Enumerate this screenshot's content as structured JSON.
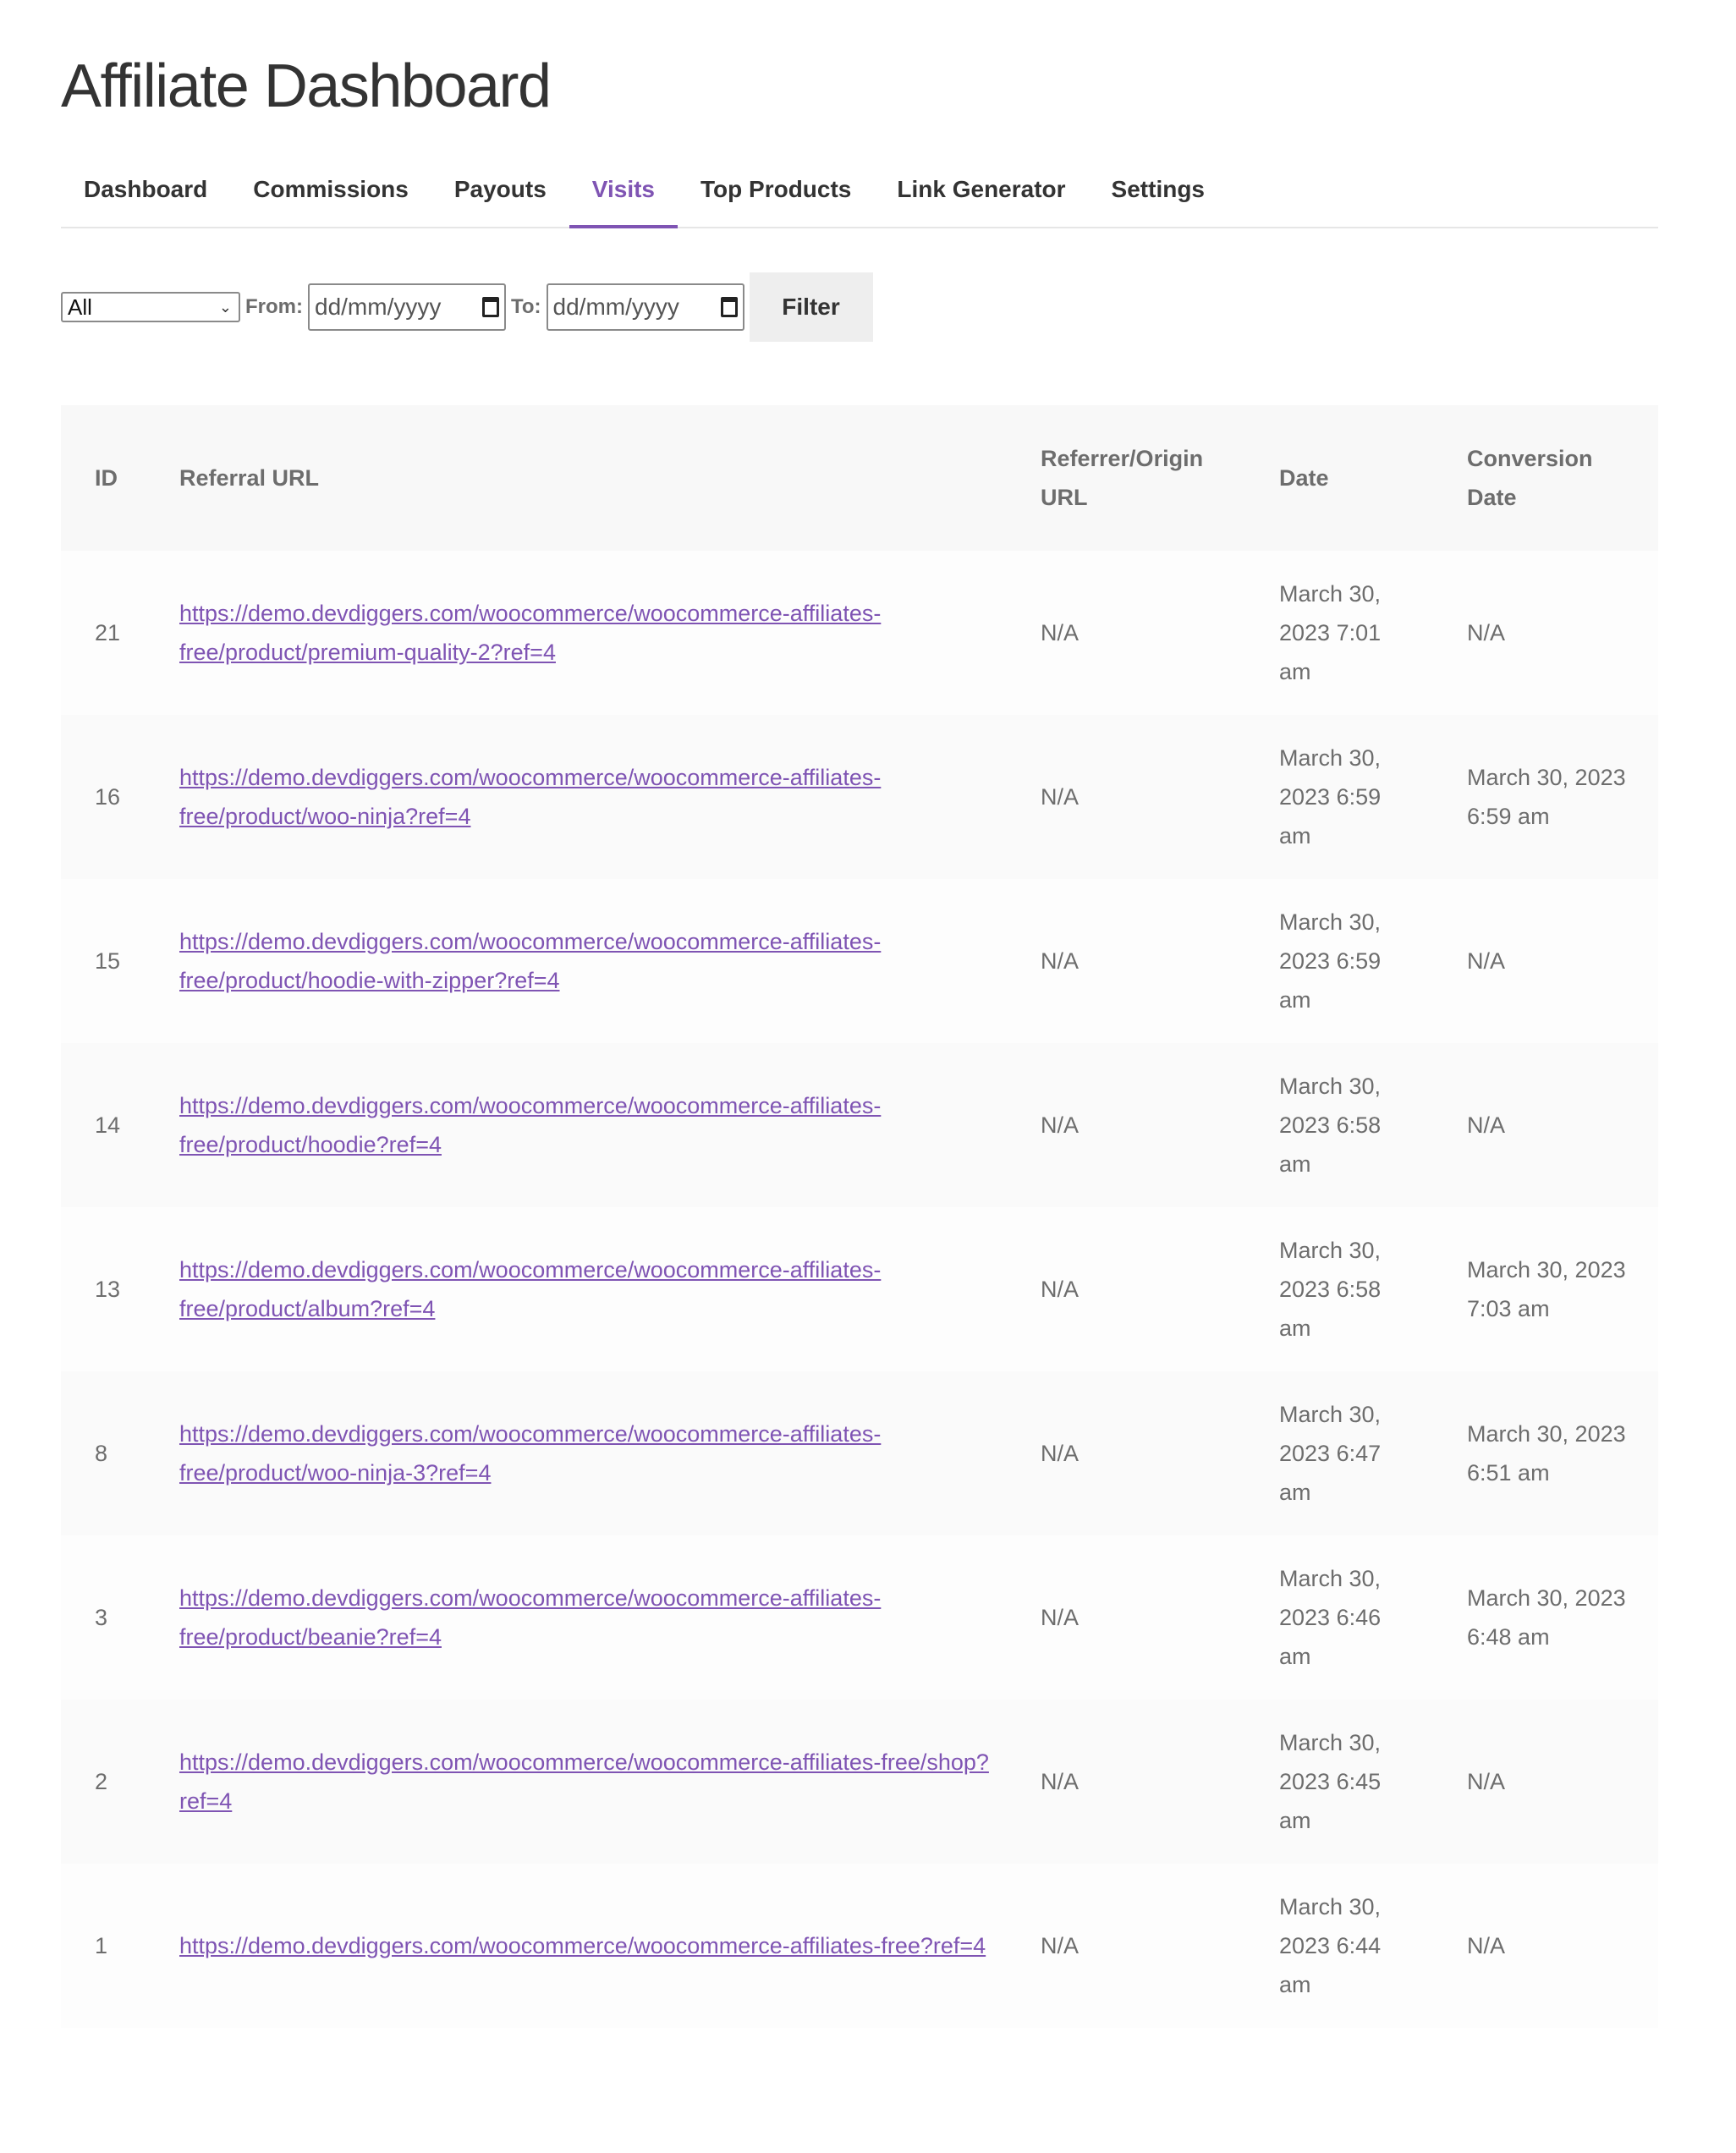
{
  "page": {
    "title": "Affiliate Dashboard"
  },
  "tabs": [
    {
      "label": "Dashboard",
      "active": false
    },
    {
      "label": "Commissions",
      "active": false
    },
    {
      "label": "Payouts",
      "active": false
    },
    {
      "label": "Visits",
      "active": true
    },
    {
      "label": "Top Products",
      "active": false
    },
    {
      "label": "Link Generator",
      "active": false
    },
    {
      "label": "Settings",
      "active": false
    }
  ],
  "filters": {
    "status_select": {
      "value": "All",
      "icon": "chevron-down-icon"
    },
    "from_label": "From:",
    "from_placeholder": "dd/mm/yyyy",
    "to_label": "To:",
    "to_placeholder": "dd/mm/yyyy",
    "date_icon": "calendar-icon",
    "filter_button": "Filter"
  },
  "table": {
    "headers": [
      "ID",
      "Referral URL",
      "Referrer/Origin URL",
      "Date",
      "Conversion Date"
    ],
    "rows": [
      {
        "id": "21",
        "url": "https://demo.devdiggers.com/woocommerce/woocommerce-affiliates-free/product/premium-quality-2?ref=4",
        "referrer": "N/A",
        "date": "March 30, 2023 7:01 am",
        "conversion": "N/A"
      },
      {
        "id": "16",
        "url": "https://demo.devdiggers.com/woocommerce/woocommerce-affiliates-free/product/woo-ninja?ref=4",
        "referrer": "N/A",
        "date": "March 30, 2023 6:59 am",
        "conversion": "March 30, 2023 6:59 am"
      },
      {
        "id": "15",
        "url": "https://demo.devdiggers.com/woocommerce/woocommerce-affiliates-free/product/hoodie-with-zipper?ref=4",
        "referrer": "N/A",
        "date": "March 30, 2023 6:59 am",
        "conversion": "N/A"
      },
      {
        "id": "14",
        "url": "https://demo.devdiggers.com/woocommerce/woocommerce-affiliates-free/product/hoodie?ref=4",
        "referrer": "N/A",
        "date": "March 30, 2023 6:58 am",
        "conversion": "N/A"
      },
      {
        "id": "13",
        "url": "https://demo.devdiggers.com/woocommerce/woocommerce-affiliates-free/product/album?ref=4",
        "referrer": "N/A",
        "date": "March 30, 2023 6:58 am",
        "conversion": "March 30, 2023 7:03 am"
      },
      {
        "id": "8",
        "url": "https://demo.devdiggers.com/woocommerce/woocommerce-affiliates-free/product/woo-ninja-3?ref=4",
        "referrer": "N/A",
        "date": "March 30, 2023 6:47 am",
        "conversion": "March 30, 2023 6:51 am"
      },
      {
        "id": "3",
        "url": "https://demo.devdiggers.com/woocommerce/woocommerce-affiliates-free/product/beanie?ref=4",
        "referrer": "N/A",
        "date": "March 30, 2023 6:46 am",
        "conversion": "March 30, 2023 6:48 am"
      },
      {
        "id": "2",
        "url": "https://demo.devdiggers.com/woocommerce/woocommerce-affiliates-free/shop?ref=4",
        "referrer": "N/A",
        "date": "March 30, 2023 6:45 am",
        "conversion": "N/A"
      },
      {
        "id": "1",
        "url": "https://demo.devdiggers.com/woocommerce/woocommerce-affiliates-free?ref=4",
        "referrer": "N/A",
        "date": "March 30, 2023 6:44 am",
        "conversion": "N/A"
      }
    ]
  },
  "colors": {
    "accent": "#7f54b3",
    "text": "#6d6d6d",
    "header_bg": "#f8f8f8",
    "button_bg": "#eeeeee"
  }
}
